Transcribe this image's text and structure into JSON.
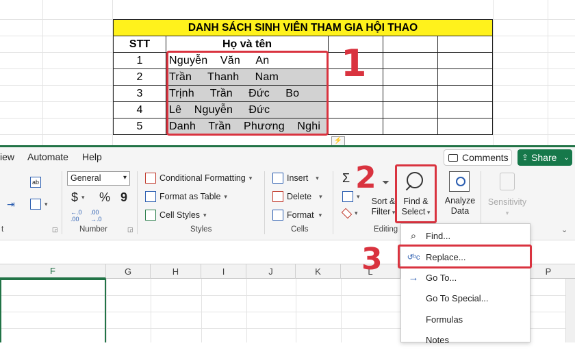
{
  "sheet": {
    "title": "DANH SÁCH SINH VIÊN THAM GIA HỘI THAO",
    "headers": [
      "STT",
      "Họ và tên"
    ],
    "rows": [
      {
        "stt": "1",
        "name": "Nguyễn    Văn     An"
      },
      {
        "stt": "2",
        "name": "Trần     Thanh     Nam"
      },
      {
        "stt": "3",
        "name": "Trịnh     Trần     Đức     Bo"
      },
      {
        "stt": "4",
        "name": "Lê    Nguyễn     Đức"
      },
      {
        "stt": "5",
        "name": "Danh    Trần    Phương    Nghi"
      }
    ]
  },
  "annotations": {
    "one": "1",
    "two": "2",
    "three": "3"
  },
  "ribbon": {
    "menus": [
      "iew",
      "Automate",
      "Help"
    ],
    "comments_label": "Comments",
    "share_label": "Share",
    "number_format": "General",
    "number_group": "Number",
    "styles": {
      "conditional": "Conditional Formatting",
      "format_table": "Format as Table",
      "cell_styles": "Cell Styles",
      "label": "Styles"
    },
    "cells": {
      "insert": "Insert",
      "delete": "Delete",
      "format": "Format",
      "label": "Cells"
    },
    "editing": {
      "sort_filter_1": "Sort &",
      "sort_filter_2": "Filter",
      "find_select_1": "Find &",
      "find_select_2": "Select",
      "label": "Editing"
    },
    "analyze_1": "Analyze",
    "analyze_2": "Data",
    "sensitivity": "Sensitivity",
    "partial_label": "t",
    "currency": "$",
    "percent": "%",
    "comma": "9"
  },
  "columns": [
    "F",
    "G",
    "H",
    "I",
    "J",
    "K",
    "L",
    "P"
  ],
  "dropdown": {
    "items": [
      "Find...",
      "Replace...",
      "Go To...",
      "Go To Special...",
      "Formulas",
      "Notes"
    ]
  },
  "colors": {
    "accent": "#217346",
    "annotation": "#d9333f",
    "title_fill": "#fff21c"
  }
}
